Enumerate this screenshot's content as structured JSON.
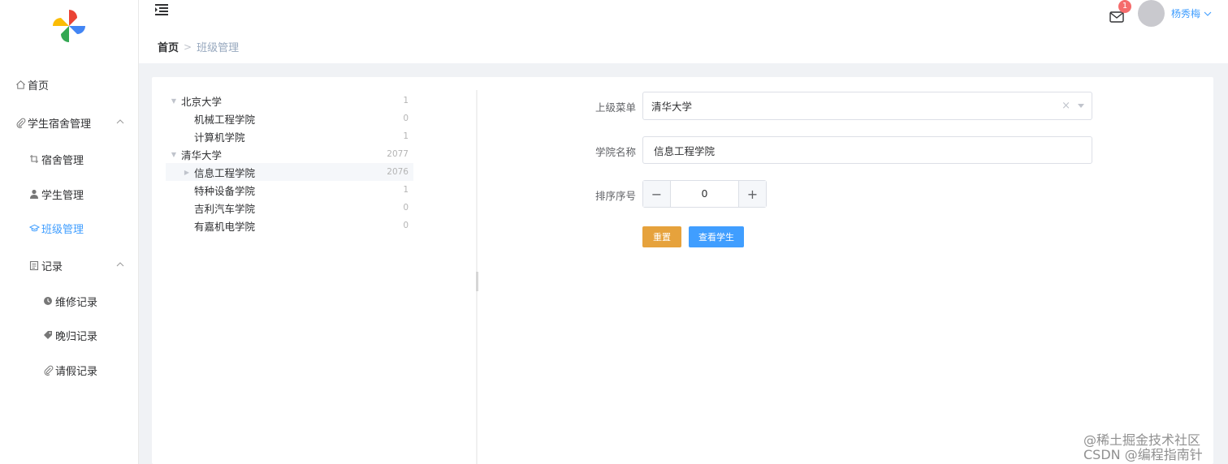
{
  "sidebar": {
    "items": [
      {
        "label": "首页",
        "icon": "home-icon"
      },
      {
        "label": "学生宿舍管理",
        "icon": "paperclip-icon",
        "expanded": true
      },
      {
        "label": "宿舍管理",
        "icon": "crop-icon"
      },
      {
        "label": "学生管理",
        "icon": "user-icon"
      },
      {
        "label": "班级管理",
        "icon": "graduation-cap-icon",
        "active": true
      },
      {
        "label": "记录",
        "icon": "document-icon",
        "expanded": true
      },
      {
        "label": "维修记录",
        "icon": "clock-icon"
      },
      {
        "label": "晚归记录",
        "icon": "tag-icon"
      },
      {
        "label": "请假记录",
        "icon": "paperclip-icon"
      }
    ]
  },
  "header": {
    "breadcrumb": {
      "home": "首页",
      "current": "班级管理"
    },
    "notification_count": "1",
    "username": "杨秀梅"
  },
  "tree": {
    "nodes": [
      {
        "label": "北京大学",
        "count": "1",
        "level": 0,
        "expanded": true
      },
      {
        "label": "机械工程学院",
        "count": "0",
        "level": 1
      },
      {
        "label": "计算机学院",
        "count": "1",
        "level": 1
      },
      {
        "label": "清华大学",
        "count": "2077",
        "level": 0,
        "expanded": true
      },
      {
        "label": "信息工程学院",
        "count": "2076",
        "level": 1,
        "selected": true,
        "has_children": true
      },
      {
        "label": "特种设备学院",
        "count": "1",
        "level": 1
      },
      {
        "label": "吉利汽车学院",
        "count": "0",
        "level": 1
      },
      {
        "label": "有嘉机电学院",
        "count": "0",
        "level": 1
      }
    ]
  },
  "form": {
    "parent_label": "上级菜单",
    "parent_value": "清华大学",
    "name_label": "学院名称",
    "name_value": "信息工程学院",
    "order_label": "排序序号",
    "order_value": "0",
    "reset_button": "重置",
    "view_button": "查看学生"
  },
  "watermark": {
    "line1": "@稀土掘金技术社区",
    "line2": "CSDN @编程指南针"
  },
  "colors": {
    "primary": "#409eff",
    "warning": "#e6a23c",
    "danger": "#f56c6c"
  }
}
